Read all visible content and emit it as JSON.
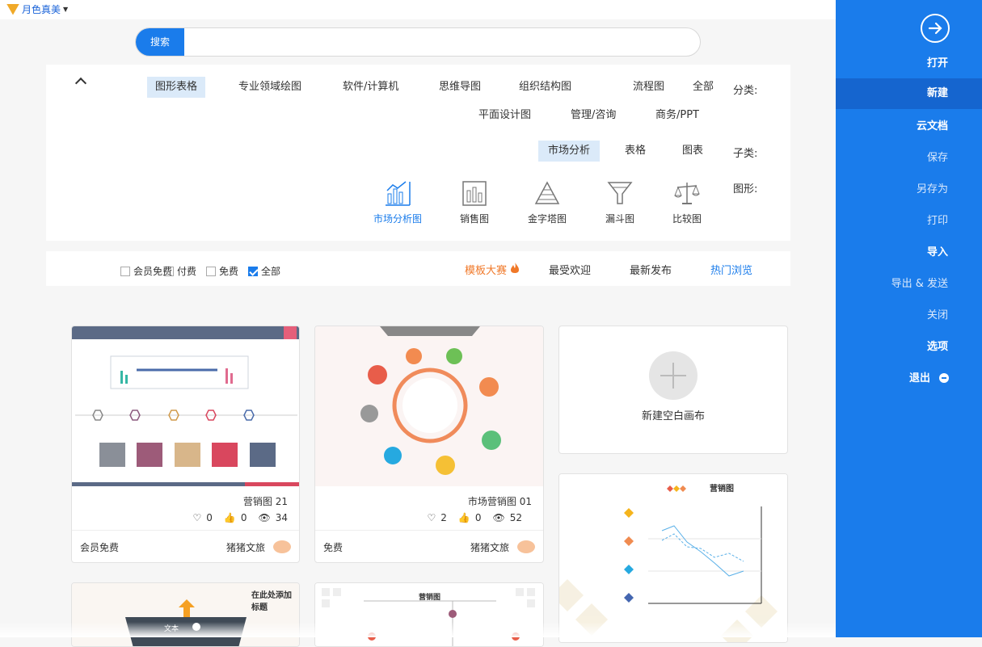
{
  "topbar": {
    "brand": "月色真美"
  },
  "sidebar": {
    "items": [
      {
        "label": "打开",
        "style": "bold"
      },
      {
        "label": "新建",
        "style": "bold active"
      },
      {
        "label": "云文档",
        "style": "bold"
      },
      {
        "label": "保存",
        "style": "light"
      },
      {
        "label": "另存为",
        "style": "light"
      },
      {
        "label": "打印",
        "style": "light"
      },
      {
        "label": "导入",
        "style": "bold"
      },
      {
        "label": "导出 & 发送",
        "style": "light"
      },
      {
        "label": "关闭",
        "style": "light"
      },
      {
        "label": "选项",
        "style": "bold"
      },
      {
        "label": "退出",
        "style": "bold"
      }
    ]
  },
  "search": {
    "button_label": "搜索",
    "placeholder": ""
  },
  "categories": {
    "label": "分类:",
    "row1": [
      "全部",
      "流程图",
      "组织结构图",
      "思维导图",
      "软件/计算机",
      "专业领域绘图",
      "图形表格"
    ],
    "row2": [
      "商务/PPT",
      "管理/咨询",
      "平面设计图"
    ],
    "selected": "图形表格"
  },
  "subcategories": {
    "label": "子类:",
    "items": [
      "图表",
      "表格",
      "市场分析"
    ],
    "selected": "市场分析"
  },
  "shapes": {
    "label": "图形:",
    "items": [
      "比较图",
      "漏斗图",
      "金字塔图",
      "销售图",
      "市场分析图"
    ],
    "selected": "市场分析图"
  },
  "filters": {
    "tabs": [
      "热门浏览",
      "最新发布",
      "最受欢迎",
      "模板大赛"
    ],
    "selected": "热门浏览",
    "checks": [
      "全部",
      "免费",
      "付费",
      "会员免费"
    ],
    "checked": "全部"
  },
  "new_canvas": {
    "label": "新建空白画布"
  },
  "cards": [
    {
      "title": "营销图 21",
      "views": "34",
      "likes": "0",
      "favs": "0",
      "author": "猪猪文旅",
      "price": "会员免费"
    },
    {
      "title": "市场营销图 01",
      "views": "52",
      "likes": "0",
      "favs": "2",
      "author": "猪猪文旅",
      "price": "免费"
    },
    {
      "thumb_title": "营销图"
    },
    {
      "thumb_title": "在此处添加标题",
      "thumb_text": "文本"
    },
    {
      "thumb_title": "营销图"
    }
  ],
  "colors": {
    "accent": "#1a7ceb",
    "sidebar": "#1a7ceb",
    "fire": "#f07828"
  }
}
